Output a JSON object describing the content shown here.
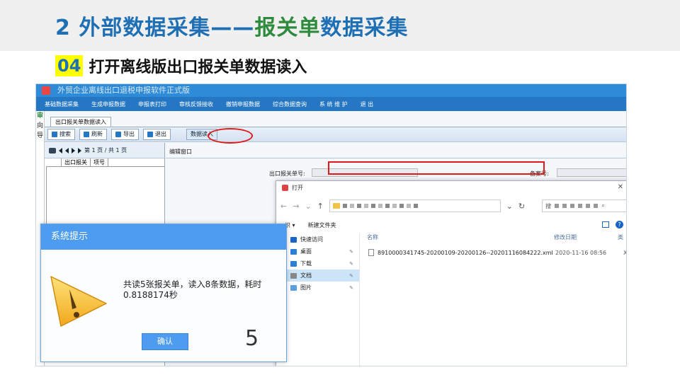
{
  "slide": {
    "title_part1": "2 外部数据采集——",
    "title_part2": "报关单",
    "title_part3": "数据采集",
    "step_number": "04",
    "step_text": "打开离线版出口报关单数据读入"
  },
  "app": {
    "window_title": "外贸企业离线出口退税申报软件正式版",
    "menu": [
      "基础数据采集",
      "生成申报数据",
      "申报表打印",
      "审核反馈接收",
      "撤销申报数据",
      "综合数据查询",
      "系 统 维 护",
      "退 出"
    ],
    "left_strip": [
      "审",
      "向",
      "导"
    ],
    "tab_label": "出口报关单数据读入",
    "toolbar": {
      "search": "搜索",
      "refresh": "刷新",
      "export": "导出",
      "exit": "退出",
      "read": "数据读入"
    },
    "pager_text": "第 1 页 / 共 1 页",
    "grid_headers": [
      "出口报关",
      "项号"
    ],
    "edit_label": "编辑窗口",
    "field_customs_no": "出口报关单号:",
    "field_record_no": "备案号:"
  },
  "file_dialog": {
    "title": "打开",
    "search_placeholder": "搜",
    "organize": "织 ▾",
    "new_folder": "新建文件夹",
    "sidebar": [
      {
        "label": "快速访问",
        "color": "#1a64c8"
      },
      {
        "label": "桌面",
        "color": "#2b7fd6"
      },
      {
        "label": "下载",
        "color": "#2b7fd6"
      },
      {
        "label": "文档",
        "color": "#888888"
      },
      {
        "label": "图片",
        "color": "#5aa0e0"
      }
    ],
    "col_name": "名称",
    "col_date": "修改日期",
    "col_type": "类",
    "file_name": "8910000341745-20200109-20200126--20201116084222.xml",
    "file_date": "2020-11-16 08:56",
    "file_type_abbr": "X"
  },
  "system_prompt": {
    "title": "系统提示",
    "message": "共读5张报关单，读入8条数据，耗时0.8188174秒",
    "ok_label": "确认",
    "count": "5"
  }
}
